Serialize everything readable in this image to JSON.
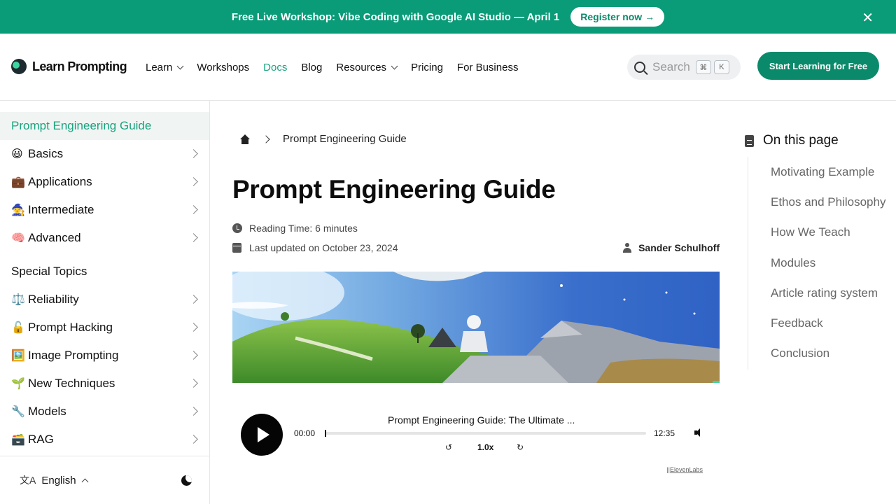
{
  "banner": {
    "text": "Free Live Workshop: Vibe Coding with Google AI Studio — April 1",
    "button": "Register now →",
    "close": "✕"
  },
  "header": {
    "logo": "Learn Prompting",
    "nav": [
      "Learn",
      "Workshops",
      "Docs",
      "Blog",
      "Resources",
      "Pricing",
      "For Business"
    ],
    "active_nav": "Docs",
    "search": {
      "label": "Search",
      "key1": "⌘",
      "key2": "K"
    },
    "cta": "Start Learning for Free"
  },
  "sidebar": {
    "current": "Prompt Engineering Guide",
    "groups": [
      {
        "emoji": "😃",
        "label": "Basics"
      },
      {
        "emoji": "💼",
        "label": "Applications"
      },
      {
        "emoji": "🧙",
        "label": "Intermediate"
      },
      {
        "emoji": "🧠",
        "label": "Advanced"
      }
    ],
    "section_title": "Special Topics",
    "special": [
      {
        "emoji": "⚖️",
        "label": "Reliability"
      },
      {
        "emoji": "🔓",
        "label": "Prompt Hacking"
      },
      {
        "emoji": "🖼️",
        "label": "Image Prompting"
      },
      {
        "emoji": "🌱",
        "label": "New Techniques"
      },
      {
        "emoji": "🔧",
        "label": "Models"
      },
      {
        "emoji": "🗃️",
        "label": "RAG"
      }
    ],
    "language": "English",
    "language_icon": "文A"
  },
  "main": {
    "breadcrumb": "Prompt Engineering Guide",
    "title": "Prompt Engineering Guide",
    "reading_time": "Reading Time: 6 minutes",
    "last_updated": "Last updated on October 23, 2024",
    "author": "Sander Schulhoff"
  },
  "player": {
    "title": "Prompt Engineering Guide: The Ultimate ...",
    "current_time": "00:00",
    "duration": "12:35",
    "rate": "1.0x",
    "rewind": "↺",
    "forward": "↻",
    "credit": "||ElevenLabs",
    "progress": 0
  },
  "toc": {
    "heading": "On this page",
    "items": [
      "Motivating Example",
      "Ethos and Philosophy",
      "How We Teach",
      "Modules",
      "Article rating system",
      "Feedback",
      "Conclusion"
    ]
  },
  "colors": {
    "brand": "#0a9b78",
    "accent": "#18a37f",
    "text": "#111111"
  },
  "icons": [
    "close-icon",
    "chevron-down-icon",
    "search-icon",
    "chevron-right-icon",
    "translate-icon",
    "moon-icon",
    "home-icon",
    "clock-icon",
    "calendar-icon",
    "person-icon",
    "play-icon",
    "volume-icon",
    "document-icon"
  ]
}
